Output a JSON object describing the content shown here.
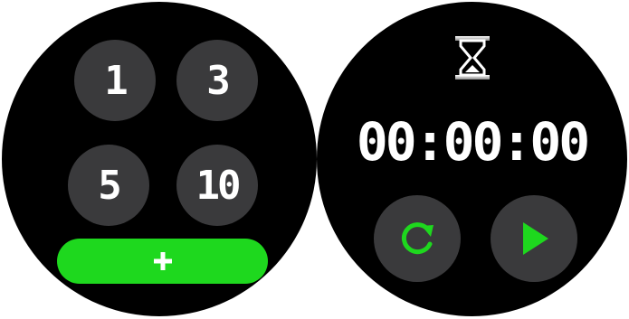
{
  "presets": {
    "items": [
      {
        "label": "1"
      },
      {
        "label": "3"
      },
      {
        "label": "5"
      },
      {
        "label": "10"
      }
    ],
    "add_icon": "plus-icon"
  },
  "timer": {
    "icon": "hourglass-icon",
    "time": "00:00:00",
    "reset_icon": "restart-icon",
    "play_icon": "play-icon"
  },
  "colors": {
    "background": "#000000",
    "button": "#3a3a3c",
    "accent": "#1ed81e",
    "text": "#ffffff"
  }
}
